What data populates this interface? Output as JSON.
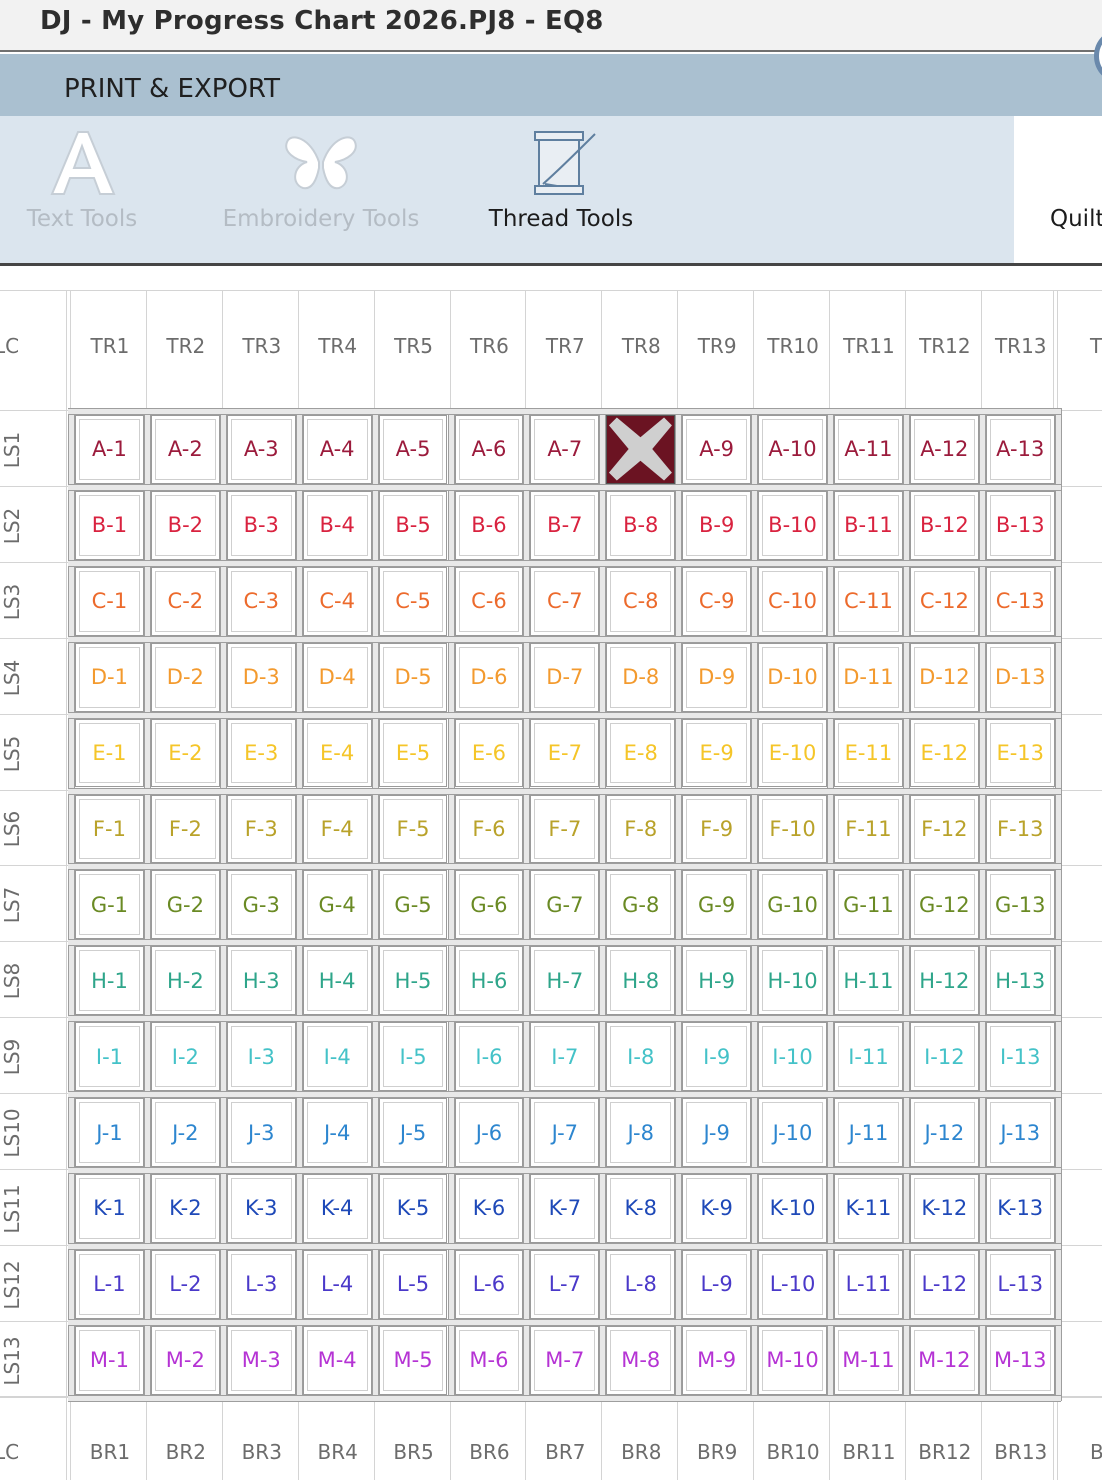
{
  "window": {
    "title": "DJ - My Progress Chart 2026.PJ8 - EQ8"
  },
  "section": {
    "title": "PRINT & EXPORT"
  },
  "ribbon": {
    "items": [
      {
        "label": "Text Tools",
        "enabled": false,
        "icon": "letter-a-icon"
      },
      {
        "label": "Embroidery Tools",
        "enabled": false,
        "icon": "butterfly-icon"
      },
      {
        "label": "Thread Tools",
        "enabled": true,
        "icon": "thread-spool-icon"
      },
      {
        "label": "Quilt",
        "enabled": true,
        "icon": "quilt-icon"
      }
    ]
  },
  "quilt": {
    "corner_label": "LC",
    "top_row": [
      "TR1",
      "TR2",
      "TR3",
      "TR4",
      "TR5",
      "TR6",
      "TR7",
      "TR8",
      "TR9",
      "TR10",
      "TR11",
      "TR12",
      "TR13",
      "T"
    ],
    "bottom_row": [
      "BR1",
      "BR2",
      "BR3",
      "BR4",
      "BR5",
      "BR6",
      "BR7",
      "BR8",
      "BR9",
      "BR10",
      "BR11",
      "BR12",
      "BR13",
      "B"
    ],
    "left_side": [
      "LS1",
      "LS2",
      "LS3",
      "LS4",
      "LS5",
      "LS6",
      "LS7",
      "LS8",
      "LS9",
      "LS10",
      "LS11",
      "LS12",
      "LS13"
    ],
    "rows": [
      {
        "letter": "A",
        "color": "#9b1b3c"
      },
      {
        "letter": "B",
        "color": "#d9223f"
      },
      {
        "letter": "C",
        "color": "#ec6a2c"
      },
      {
        "letter": "D",
        "color": "#f39a2e"
      },
      {
        "letter": "E",
        "color": "#f5c528"
      },
      {
        "letter": "F",
        "color": "#b9a22a"
      },
      {
        "letter": "G",
        "color": "#6a8a24"
      },
      {
        "letter": "H",
        "color": "#2ea58a"
      },
      {
        "letter": "I",
        "color": "#44c2c8"
      },
      {
        "letter": "J",
        "color": "#2d86cf"
      },
      {
        "letter": "K",
        "color": "#1e49b8"
      },
      {
        "letter": "L",
        "color": "#4a39c9"
      },
      {
        "letter": "M",
        "color": "#b533d4"
      }
    ],
    "columns": 13,
    "completed_blocks": [
      "A-8"
    ],
    "completed_fill": "#6b1322",
    "completed_mark": "#cfcfcf"
  }
}
